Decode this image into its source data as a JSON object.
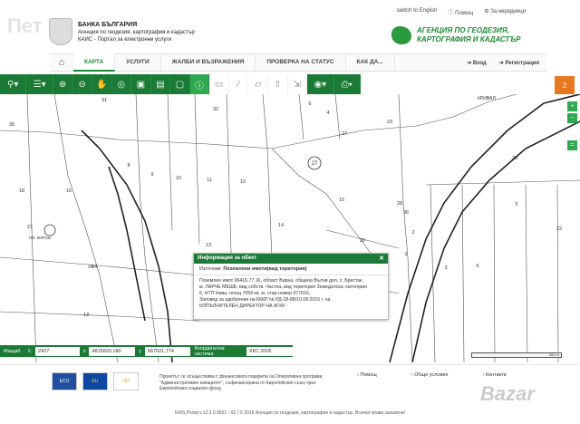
{
  "header": {
    "logo_line1": "БАНКА БЪЛГАРИЯ",
    "logo_line2": "Агенция по геодезия, картография и кадастър",
    "logo_line3": "КАИС - Портал за електронни услуги",
    "agency_line1": "АГЕНЦИЯ ПО ГЕОДЕЗИЯ,",
    "agency_line2": "КАРТОГРАФИЯ И КАДАСТЪР",
    "switch_lang": "switch to English",
    "help": "Помощ",
    "not_logged": "За нерядници",
    "watermark": "Пет"
  },
  "nav": {
    "tabs": [
      "КАРТА",
      "УСЛУГИ",
      "ЖАЛБИ И ВЪЗРАЖЕНИЯ",
      "ПРОВЕРКА НА СТАТУС",
      "КАК ДА..."
    ],
    "login": "Вход",
    "register": "Регистрация"
  },
  "map": {
    "parcels": [
      "31",
      "32",
      "6",
      "4",
      "23",
      "35",
      "8",
      "9",
      "10",
      "11",
      "12",
      "27",
      "25",
      "15",
      "18",
      "16",
      "14",
      "13",
      "24",
      "26",
      "28",
      "21",
      "36",
      "5",
      "2",
      "1",
      "24",
      "13",
      "22",
      "3",
      "6"
    ],
    "road_label": "КРИВАЛ",
    "overlay_label": "ПЛ. КИРОВ",
    "badge": "2"
  },
  "popup": {
    "title": "Информация за обект",
    "close": "✕",
    "source_label": "Източник:",
    "source_value": "Поземлени имоти(вид територия)",
    "body_lines": [
      "Поземлен имот 06416.77.16, област Варна, община Вълчи дол, с. Брестак,",
      "м. ЛАРЧЕ МЕШЕ, вид собств. Частна, вид територия Земеделска, категория",
      "6, НТП Нива, площ 7059 кв. м, стар номер 077016,",
      "Заповед за одобрение на КККР № РД-18-88/10.08.2016 г. на",
      "ИЗПЪЛНИТЕЛЕН ДИРЕКТОР НА АГКК"
    ]
  },
  "status": {
    "scale_label": "Мащаб",
    "scale_prefix": "1:",
    "scale_value": "2427",
    "x_label": "x",
    "x_value": "4815820,180",
    "y_label": "y",
    "y_value": "667021,774",
    "cs_label": "Координатна система",
    "cs_value": "ККС 2005",
    "scalebar_label": "300 m"
  },
  "footer": {
    "project_text": "Проектът се осъществява с финансовата подкрепа на Оперативна програма \"Административен капацитет\", съфинансирана от Европейския съюз чрез Европейския социален фонд.",
    "links": [
      "Помощ",
      "Общи условия",
      "Контакти"
    ],
    "copyright": "KAIS.Portal v.12.2.0.9551 - 02 | © 2016 Агенция по геодезия, картография и кадастър. Всички права запазени!",
    "logos": [
      "ECO",
      "EU",
      "ОП"
    ],
    "watermark": "Bazar"
  },
  "colors": {
    "primary": "#1b7a36",
    "accent": "#2fa84f",
    "orange": "#e87722"
  }
}
